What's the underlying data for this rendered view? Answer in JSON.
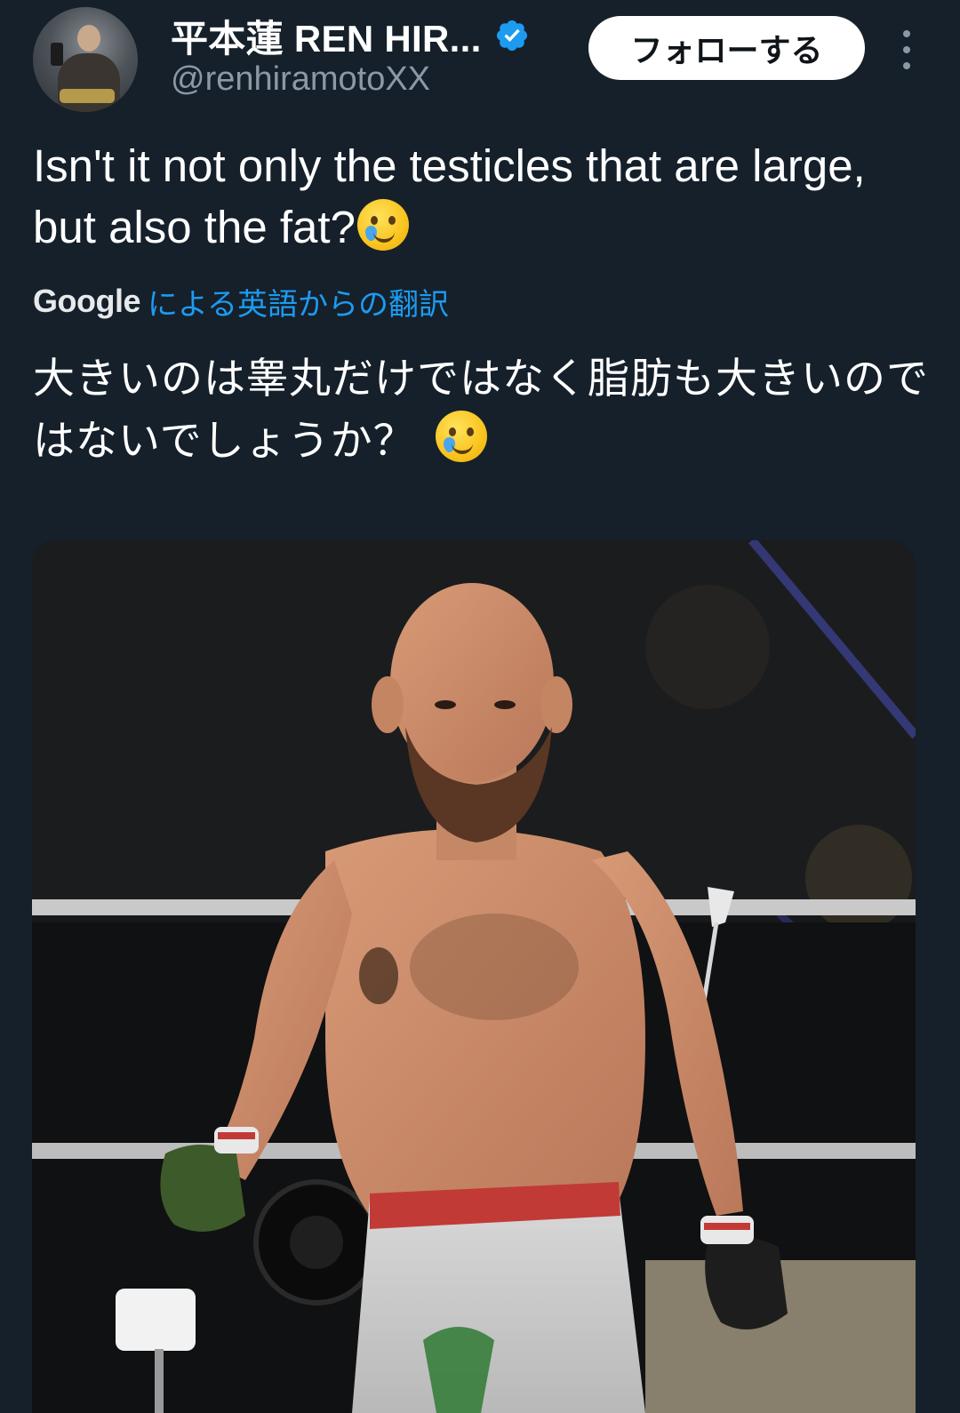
{
  "author": {
    "display_name": "平本蓮 REN HIR...",
    "handle": "@renhiramotoXX",
    "verified": true
  },
  "actions": {
    "follow_label": "フォローする"
  },
  "tweet": {
    "text": "Isn't it not only the testicles that are large, but also the fat?",
    "emoji": "crying-smile-emoji"
  },
  "translation": {
    "provider": "Google",
    "label": "による英語からの翻訳",
    "text": "大きいのは睾丸だけではなく脂肪も大きいのではないでしょうか？"
  },
  "media": {
    "type": "photo",
    "description_icon": "fighter-photo"
  },
  "colors": {
    "background": "#15202b",
    "link": "#1d9bf0",
    "secondary_text": "#8b98a5",
    "verified": "#1d9bf0"
  }
}
